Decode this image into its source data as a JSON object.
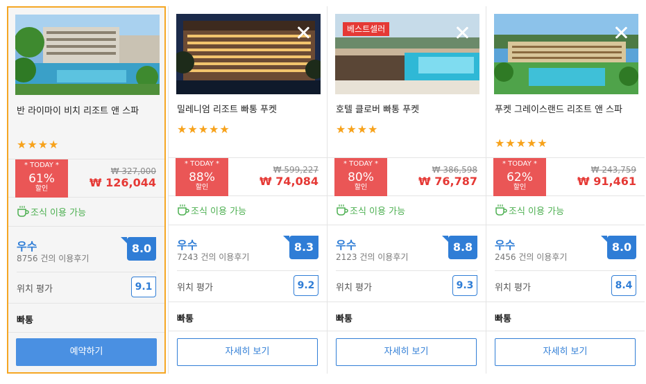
{
  "hotels": [
    {
      "name": "반 라이마이 비치 리조트 앤 스파",
      "stars": "★★★★",
      "today": "* TODAY *",
      "discount": "61%",
      "discount_label": "할인",
      "original_price": "₩ 327,000",
      "price": "₩ 126,044",
      "breakfast": "조식 이용 가능",
      "grade": "우수",
      "reviews": "8756 건의 이용후기",
      "score": "8.0",
      "location_label": "위치 평가",
      "location_score": "9.1",
      "area": "빠통",
      "button": "예약하기"
    },
    {
      "name": "밀레니엄 리조트 빠통 푸켓",
      "stars": "★★★★★",
      "today": "* TODAY *",
      "discount": "88%",
      "discount_label": "할인",
      "original_price": "₩ 599,227",
      "price": "₩ 74,084",
      "breakfast": "조식 이용 가능",
      "grade": "우수",
      "reviews": "7243 건의 이용후기",
      "score": "8.3",
      "location_label": "위치 평가",
      "location_score": "9.2",
      "area": "빠통",
      "button": "자세히 보기"
    },
    {
      "badge": "베스트셀러",
      "name": "호텔 클로버 빠통 푸켓",
      "stars": "★★★★",
      "today": "* TODAY *",
      "discount": "80%",
      "discount_label": "할인",
      "original_price": "₩ 386,598",
      "price": "₩ 76,787",
      "breakfast": "조식 이용 가능",
      "grade": "우수",
      "reviews": "2123 건의 이용후기",
      "score": "8.8",
      "location_label": "위치 평가",
      "location_score": "9.3",
      "area": "빠통",
      "button": "자세히 보기"
    },
    {
      "name": "푸켓 그레이스랜드 리조트 앤 스파",
      "stars": "★★★★★",
      "today": "* TODAY *",
      "discount": "62%",
      "discount_label": "할인",
      "original_price": "₩ 243,759",
      "price": "₩ 91,461",
      "breakfast": "조식 이용 가능",
      "grade": "우수",
      "reviews": "2456 건의 이용후기",
      "score": "8.0",
      "location_label": "위치 평가",
      "location_score": "8.4",
      "area": "빠통",
      "button": "자세히 보기"
    }
  ],
  "icons": {
    "close": "close-icon",
    "breakfast": "coffee-cup-icon",
    "star": "star-icon"
  },
  "colors": {
    "selected_border": "#f5a623",
    "discount_bg": "#ea5656",
    "price": "#e53935",
    "breakfast": "#4caf50",
    "rating": "#2f7dd6",
    "star": "#f7a21b",
    "primary_button": "#4a90e2"
  }
}
